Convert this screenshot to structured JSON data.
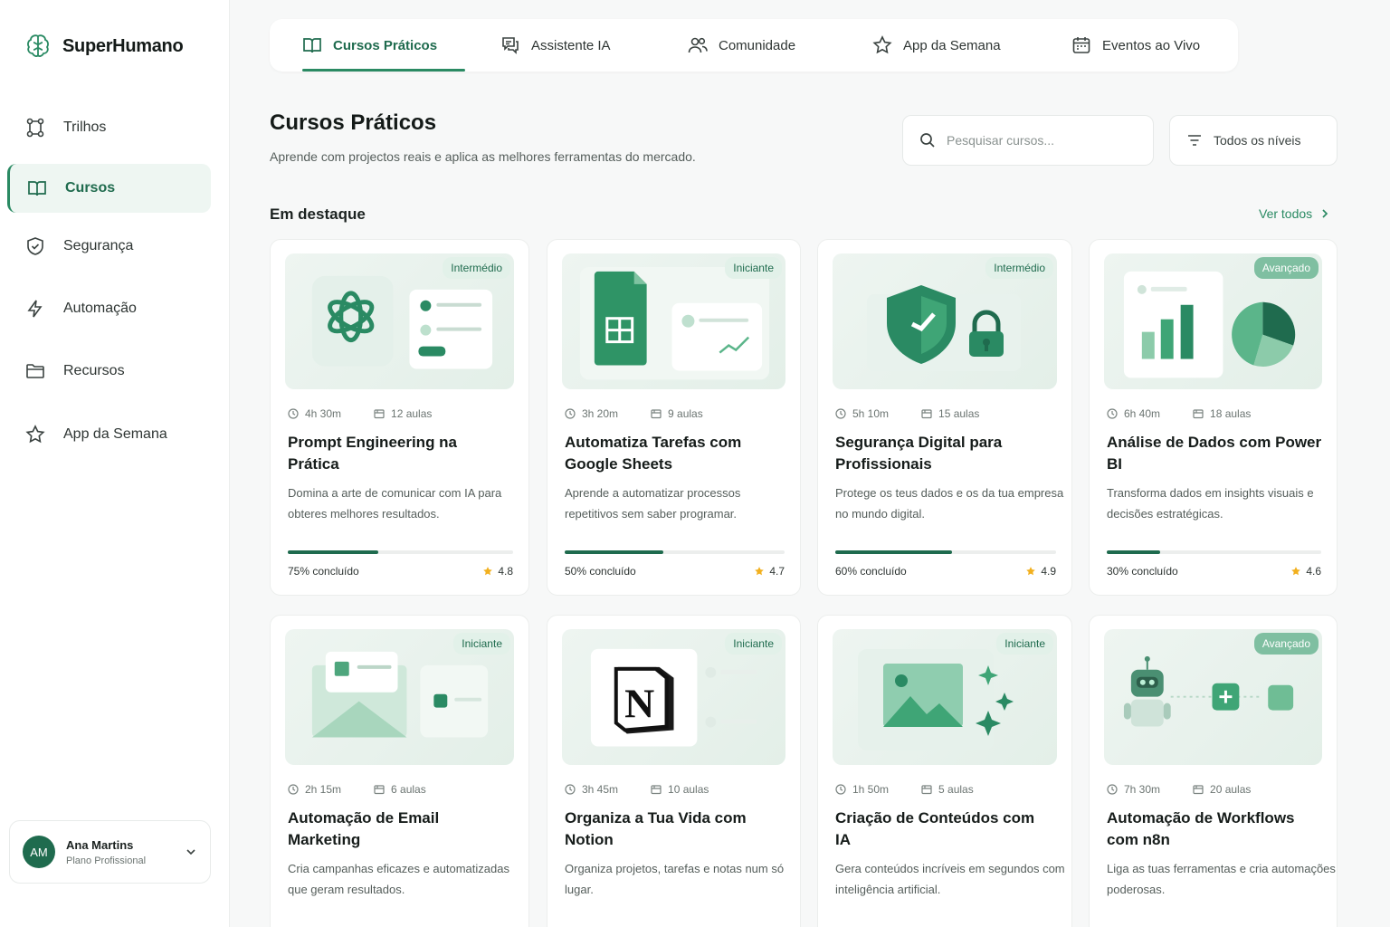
{
  "brand": {
    "name": "SuperHumano"
  },
  "sidebar": {
    "items": [
      {
        "label": "Trilhos",
        "icon": "route-icon"
      },
      {
        "label": "Cursos",
        "icon": "book-icon",
        "active": true
      },
      {
        "label": "Segurança",
        "icon": "shield-icon"
      },
      {
        "label": "Automação",
        "icon": "bolt-icon"
      },
      {
        "label": "Recursos",
        "icon": "folder-icon"
      },
      {
        "label": "App da Semana",
        "icon": "star-icon"
      }
    ]
  },
  "user": {
    "initials": "AM",
    "name": "Ana Martins",
    "plan": "Plano Profissional"
  },
  "tabs": [
    {
      "label": "Cursos Práticos",
      "icon": "book-icon",
      "active": true
    },
    {
      "label": "Assistente IA",
      "icon": "chat-icon"
    },
    {
      "label": "Comunidade",
      "icon": "users-icon"
    },
    {
      "label": "App da Semana",
      "icon": "star-icon"
    },
    {
      "label": "Eventos ao Vivo",
      "icon": "calendar-icon"
    }
  ],
  "header": {
    "title": "Cursos Práticos",
    "subtitle": "Aprende com projectos reais e aplica as melhores ferramentas do mercado."
  },
  "search": {
    "placeholder": "Pesquisar cursos..."
  },
  "filter": {
    "label": "Todos os níveis"
  },
  "section": {
    "title": "Em destaque",
    "see_all": "Ver todos"
  },
  "colors": {
    "accent": "#1f6b4e",
    "accent_light": "#e2f1e9",
    "star": "#f2b01e"
  },
  "courses": [
    {
      "badge": "Intermédio",
      "duration": "4h 30m",
      "lessons": "12 aulas",
      "title": "Prompt Engineering na Prática",
      "desc": "Domina a arte de comunicar com IA para obteres melhores resultados.",
      "progress_label": "75% concluído",
      "progress": 40,
      "rating": "4.8",
      "art": "openai"
    },
    {
      "badge": "Iniciante",
      "duration": "3h 20m",
      "lessons": "9 aulas",
      "title": "Automatiza Tarefas com Google Sheets",
      "desc": "Aprende a automatizar processos repetitivos sem saber programar.",
      "progress_label": "50% concluído",
      "progress": 45,
      "rating": "4.7",
      "art": "sheets"
    },
    {
      "badge": "Intermédio",
      "duration": "5h 10m",
      "lessons": "15 aulas",
      "title": "Segurança Digital para Profissionais",
      "desc": "Protege os teus dados e os da tua empresa no mundo digital.",
      "progress_label": "60% concluído",
      "progress": 53,
      "rating": "4.9",
      "art": "shield"
    },
    {
      "badge": "Avançado",
      "duration": "6h 40m",
      "lessons": "18 aulas",
      "title": "Análise de Dados com Power BI",
      "desc": "Transforma dados em insights visuais e decisões estratégicas.",
      "progress_label": "30% concluído",
      "progress": 25,
      "rating": "4.6",
      "art": "chart"
    },
    {
      "badge": "Iniciante",
      "duration": "2h 15m",
      "lessons": "6 aulas",
      "title": "Automação de Email Marketing",
      "desc": "Cria campanhas eficazes e automatizadas que geram resultados.",
      "art": "email"
    },
    {
      "badge": "Iniciante",
      "duration": "3h 45m",
      "lessons": "10 aulas",
      "title": "Organiza a Tua Vida com Notion",
      "desc": "Organiza projetos, tarefas e notas num só lugar.",
      "art": "notion"
    },
    {
      "badge": "Iniciante",
      "duration": "1h 50m",
      "lessons": "5 aulas",
      "title": "Criação de Conteúdos com IA",
      "desc": "Gera conteúdos incríveis em segundos com inteligência artificial.",
      "art": "image"
    },
    {
      "badge": "Avançado",
      "duration": "7h 30m",
      "lessons": "20 aulas",
      "title": "Automação de Workflows com n8n",
      "desc": "Liga as tuas ferramentas e cria automações poderosas.",
      "art": "robot"
    }
  ]
}
